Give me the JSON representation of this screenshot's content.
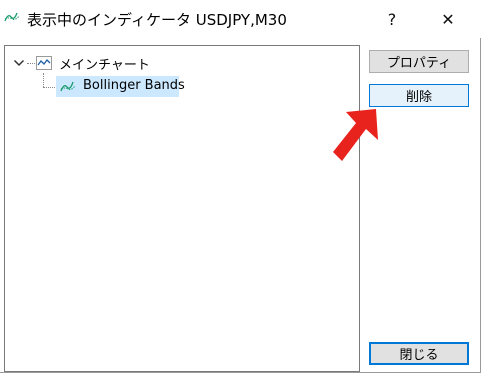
{
  "window": {
    "title": "表示中のインディケータ USDJPY,M30",
    "help_label": "?",
    "close_label": "✕"
  },
  "tree": {
    "root": {
      "label": "メインチャート",
      "icon": "line-chart-icon",
      "expanded": true
    },
    "children": [
      {
        "label": "Bollinger Bands",
        "icon": "indicator-icon",
        "selected": true
      }
    ]
  },
  "buttons": {
    "properties_label": "プロパティ",
    "delete_label": "削除",
    "close_label": "閉じる"
  },
  "colors": {
    "selection": "#cce8ff",
    "accent": "#0078d7",
    "indicator_icon": "#1a9b6c",
    "annotation_arrow": "#e8231e"
  }
}
